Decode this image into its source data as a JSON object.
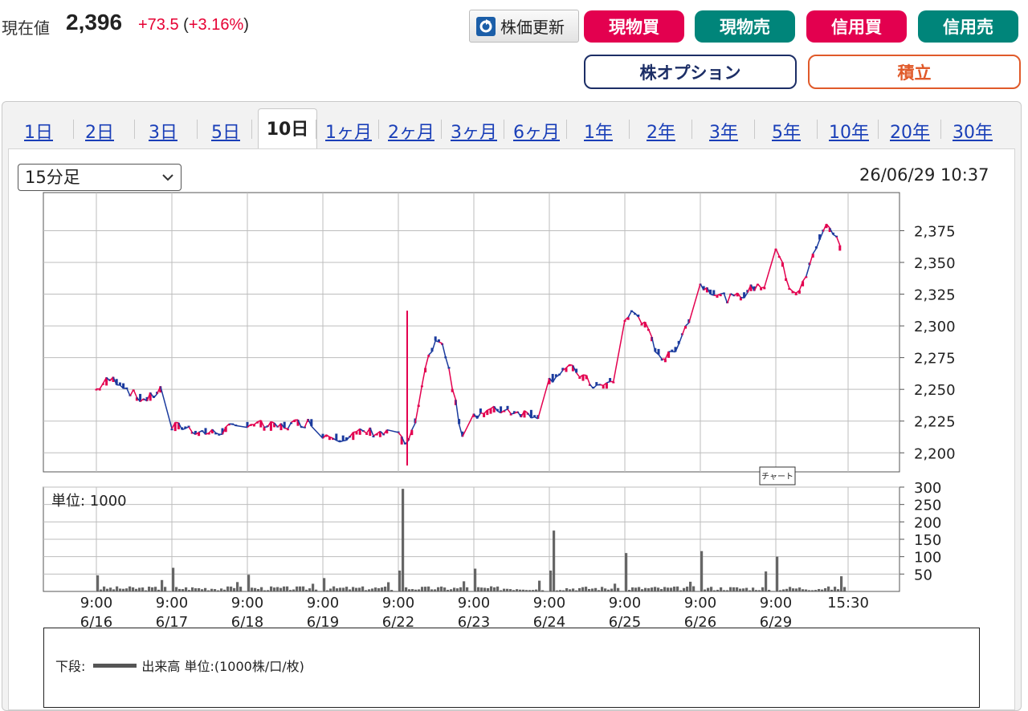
{
  "quote": {
    "label": "現在値",
    "price": "2,396",
    "change": "+73.5",
    "change_pct_open": "(",
    "change_pct": "+3.16%",
    "change_pct_close": ")"
  },
  "toolbar": {
    "update_label": "株価更新",
    "buy_spot": "現物買",
    "sell_spot": "現物売",
    "buy_margin": "信用買",
    "sell_margin": "信用売",
    "stock_option": "株オプション",
    "accumulate": "積立"
  },
  "tabs": [
    "1日",
    "2日",
    "3日",
    "5日",
    "10日",
    "1ヶ月",
    "2ヶ月",
    "3ヶ月",
    "6ヶ月",
    "1年",
    "2年",
    "3年",
    "5年",
    "10年",
    "20年",
    "30年"
  ],
  "active_tab": "10日",
  "interval_select": {
    "value": "15分足"
  },
  "timestamp": "26/06/29 10:37",
  "colors": {
    "up": "#e3004f",
    "down": "#1b3b9e",
    "volume": "#666666",
    "grid": "#bdbdbd"
  },
  "chart_data": [
    {
      "type": "line",
      "title": "",
      "tooltip": "チャート",
      "x": [
        "6/16",
        "6/17",
        "6/18",
        "6/19",
        "6/22",
        "6/23",
        "6/24",
        "6/25",
        "6/26",
        "6/29"
      ],
      "x_time": "9:00",
      "x_extra_tick": "15:30",
      "y_ticks": [
        "2,200",
        "2,225",
        "2,250",
        "2,275",
        "2,300",
        "2,325",
        "2,350",
        "2,375"
      ],
      "ylim": [
        2185,
        2405
      ],
      "series": [
        {
          "values": [
            2240,
            2215,
            2220,
            2212,
            2195,
            2230,
            2250,
            2270,
            2320,
            2320
          ]
        },
        {
          "values": [
            2262,
            2222,
            2225,
            2218,
            2312,
            2235,
            2270,
            2320,
            2335,
            2392
          ]
        }
      ]
    },
    {
      "type": "bar",
      "title": "単位: 1000",
      "y_ticks": [
        "50",
        "100",
        "150",
        "200",
        "250",
        "300"
      ],
      "ylim": [
        0,
        300
      ],
      "x": [
        "6/16",
        "6/17",
        "6/18",
        "6/19",
        "6/22",
        "6/23",
        "6/24",
        "6/25",
        "6/26",
        "6/29"
      ],
      "values": [
        58,
        85,
        60,
        48,
        295,
        82,
        175,
        138,
        145,
        125
      ]
    }
  ],
  "legend": {
    "prefix": "下段:",
    "series_label": "出来高 単位:(1000株/口/枚)"
  }
}
